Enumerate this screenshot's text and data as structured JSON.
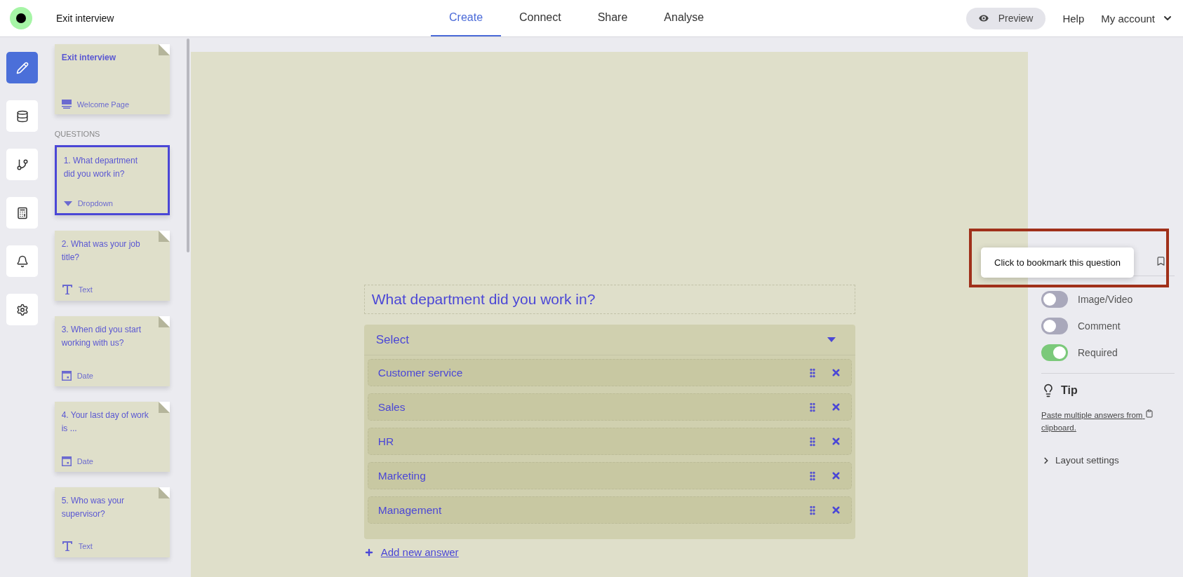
{
  "header": {
    "title": "Exit interview",
    "tabs": [
      {
        "label": "Create",
        "selected": true
      },
      {
        "label": "Connect",
        "selected": false
      },
      {
        "label": "Share",
        "selected": false
      },
      {
        "label": "Analyse",
        "selected": false
      }
    ],
    "preview": "Preview",
    "help": "Help",
    "account": "My account"
  },
  "rail": [
    {
      "kind": "edit",
      "selected": true
    },
    {
      "kind": "data",
      "selected": false
    },
    {
      "kind": "logic",
      "selected": false
    },
    {
      "kind": "calculator",
      "selected": false
    },
    {
      "kind": "notifications",
      "selected": false
    },
    {
      "kind": "settings",
      "selected": false
    }
  ],
  "welcome_card": {
    "title": "Exit interview",
    "kind": "welcome",
    "type_label": "Welcome Page"
  },
  "questions_heading": "QUESTIONS",
  "questions": [
    {
      "text": "1. What department did you work in?",
      "kind": "dropdown",
      "type_label": "Dropdown",
      "selected": true
    },
    {
      "text": "2. What was your job title?",
      "kind": "text",
      "type_label": "Text",
      "selected": false
    },
    {
      "text": "3. When did you start working with us?",
      "kind": "date",
      "type_label": "Date",
      "selected": false
    },
    {
      "text": "4. Your last day of work is ...",
      "kind": "date",
      "type_label": "Date",
      "selected": false
    },
    {
      "text": "5. Who was your supervisor?",
      "kind": "text",
      "type_label": "Text",
      "selected": false
    }
  ],
  "editor": {
    "question": "What department did you work in?",
    "select_placeholder": "Select",
    "answers": [
      "Customer service",
      "Sales",
      "HR",
      "Marketing",
      "Management"
    ],
    "add_answer": "Add new answer"
  },
  "settings": {
    "tooltip": "Click to bookmark this question",
    "toggles": [
      {
        "label": "Image/Video",
        "on": false
      },
      {
        "label": "Comment",
        "on": false
      },
      {
        "label": "Required",
        "on": true
      }
    ],
    "tip_title": "Tip",
    "tip_link": "Paste multiple answers from",
    "tip_link_2": "clipboard.",
    "layout": "Layout settings"
  }
}
